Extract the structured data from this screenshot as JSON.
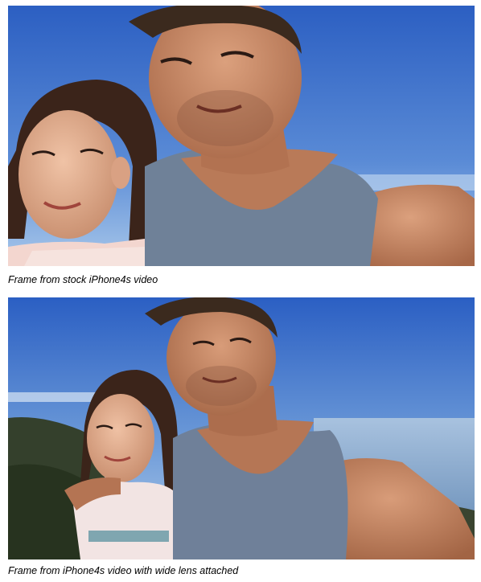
{
  "frames": [
    {
      "caption": "Frame from stock iPhone4s video",
      "image_subject": "selfie-photo-stock-lens"
    },
    {
      "caption": "Frame from iPhone4s video with wide lens attached",
      "image_subject": "selfie-photo-wide-lens"
    }
  ],
  "colors": {
    "sky_top": "#2f63c4",
    "sky_bottom": "#9cc0e6",
    "skin": "#c98a68",
    "skin_shadow": "#a9674a",
    "hair_dark": "#3a2418",
    "tank_top": "#6d7f96",
    "ocean": "#7fa1c4",
    "hills": "#2f3a28"
  }
}
